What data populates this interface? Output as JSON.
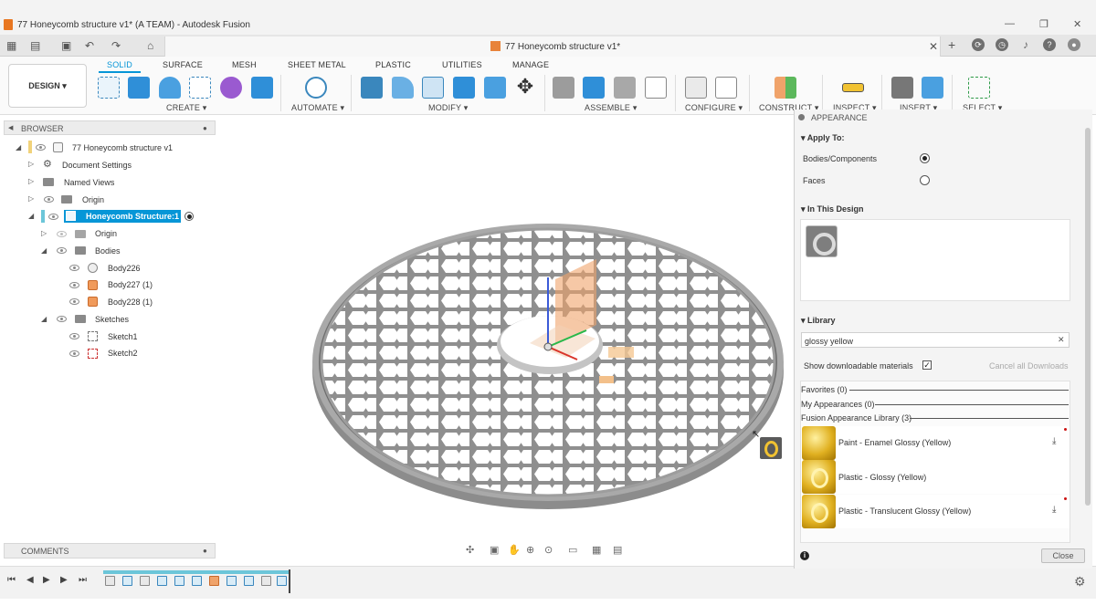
{
  "window": {
    "title": "77 Honeycomb structure v1* (A TEAM) - Autodesk Fusion",
    "controls": [
      "—",
      "❐",
      "✕"
    ]
  },
  "doc_tab": {
    "title": "77 Honeycomb structure v1*",
    "close": "✕"
  },
  "ribbon": {
    "workspace": "DESIGN ▾",
    "tabs": [
      "SOLID",
      "SURFACE",
      "MESH",
      "SHEET METAL",
      "PLASTIC",
      "UTILITIES",
      "MANAGE"
    ],
    "groups": [
      "CREATE ▾",
      "AUTOMATE ▾",
      "MODIFY ▾",
      "ASSEMBLE ▾",
      "CONFIGURE ▾",
      "CONSTRUCT ▾",
      "INSPECT ▾",
      "INSERT ▾",
      "SELECT ▾"
    ]
  },
  "browser": {
    "title": "BROWSER",
    "items": [
      "77 Honeycomb structure v1",
      "Document Settings",
      "Named Views",
      "Origin",
      "Honeycomb Structure:1",
      "Origin",
      "Bodies",
      "Body226",
      "Body227 (1)",
      "Body228 (1)",
      "Sketches",
      "Sketch1",
      "Sketch2"
    ]
  },
  "comments": {
    "title": "COMMENTS"
  },
  "appearance": {
    "title": "APPEARANCE",
    "apply_to": {
      "header": "Apply To:",
      "bodies": "Bodies/Components",
      "faces": "Faces",
      "selected": "Bodies/Components"
    },
    "in_this_design": "In This Design",
    "library": {
      "header": "Library",
      "search_value": "glossy yellow",
      "show_downloadable": "Show downloadable materials",
      "show_downloadable_checked": true,
      "cancel_downloads": "Cancel all Downloads",
      "categories": [
        "Favorites (0)",
        "My Appearances (0)",
        "Fusion Appearance Library (3)"
      ],
      "materials": [
        "Paint - Enamel Glossy (Yellow)",
        "Plastic - Glossy (Yellow)",
        "Plastic - Translucent Glossy (Yellow)"
      ]
    },
    "close": "Close"
  },
  "colors": {
    "accent": "#0696d7",
    "model_gray": "#9a9a9a",
    "orange": "#f0a36a"
  },
  "icons": [
    "grid-icon",
    "file-icon",
    "save-icon",
    "undo-icon",
    "redo-icon",
    "home-icon",
    "plus-icon",
    "settings-gear-icon"
  ]
}
